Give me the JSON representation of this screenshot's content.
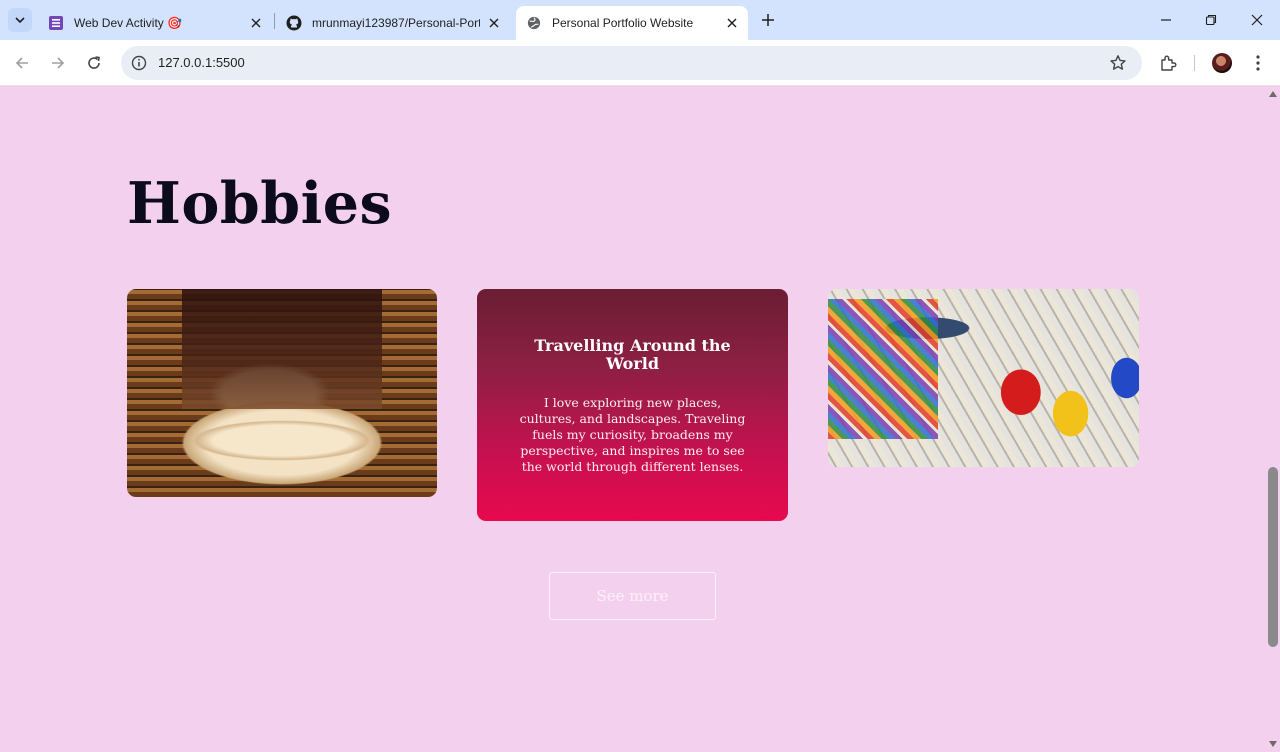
{
  "browser": {
    "tabs": [
      {
        "title": "Web Dev Activity 🎯",
        "active": false,
        "icon": "forms-icon"
      },
      {
        "title": "mrunmayi123987/Personal-Portfolio",
        "active": false,
        "icon": "github-icon"
      },
      {
        "title": "Personal Portfolio Website",
        "active": true,
        "icon": "globe-icon"
      }
    ],
    "url": "127.0.0.1:5500"
  },
  "page": {
    "heading": "Hobbies",
    "cards": [
      {
        "name": "reading",
        "image": "books-image"
      },
      {
        "name": "travelling",
        "title": "Travelling Around the World",
        "description": "I love exploring new places, cultures, and landscapes. Traveling fuels my curiosity, broadens my perspective, and inspires me to see the world through different lenses."
      },
      {
        "name": "painting",
        "image": "paints-image"
      }
    ],
    "see_more_label": "See more"
  },
  "colors": {
    "page_background": "#f3d1ee",
    "heading": "#0b0b1c",
    "travel_card_gradient_top": "#6a1e34",
    "travel_card_gradient_bottom": "#e8084f",
    "tabbar": "#d3e3fd"
  }
}
